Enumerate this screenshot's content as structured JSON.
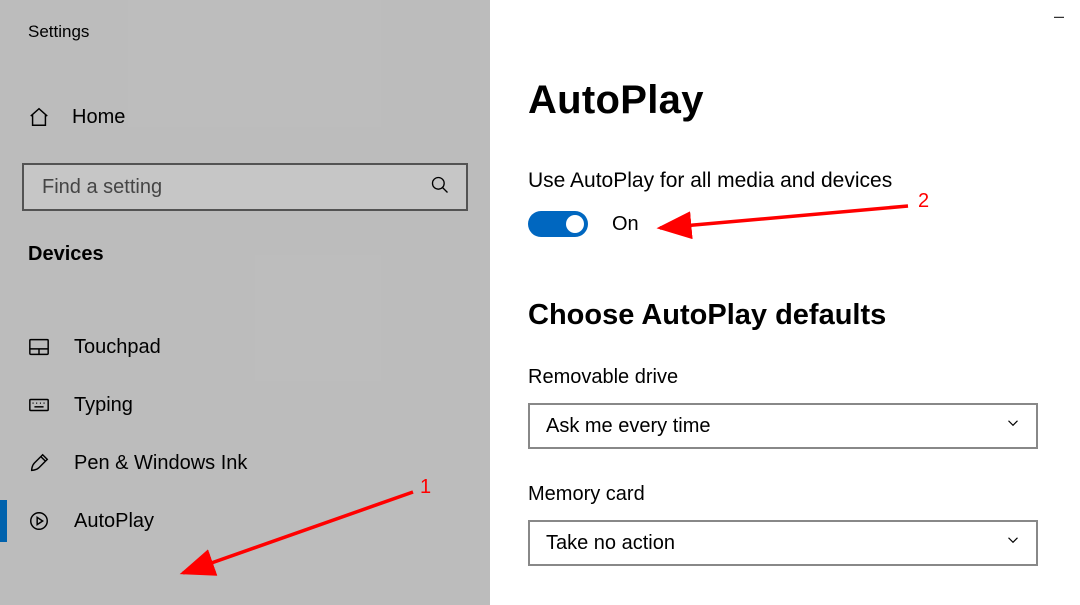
{
  "window": {
    "title": "Settings",
    "min_label": "–"
  },
  "sidebar": {
    "home_label": "Home",
    "search_placeholder": "Find a setting",
    "section": "Devices",
    "items": [
      {
        "icon": "touchpad",
        "label": "Touchpad",
        "active": false
      },
      {
        "icon": "keyboard",
        "label": "Typing",
        "active": false
      },
      {
        "icon": "pen",
        "label": "Pen & Windows Ink",
        "active": false
      },
      {
        "icon": "autoplay",
        "label": "AutoPlay",
        "active": true
      }
    ]
  },
  "main": {
    "title": "AutoPlay",
    "use_autoplay_label": "Use AutoPlay for all media and devices",
    "toggle_state": "On",
    "defaults_header": "Choose AutoPlay defaults",
    "fields": [
      {
        "label": "Removable drive",
        "value": "Ask me every time"
      },
      {
        "label": "Memory card",
        "value": "Take no action"
      }
    ]
  },
  "annotations": {
    "one": "1",
    "two": "2"
  },
  "colors": {
    "accent": "#0078d4",
    "annotation": "#ff0000"
  }
}
